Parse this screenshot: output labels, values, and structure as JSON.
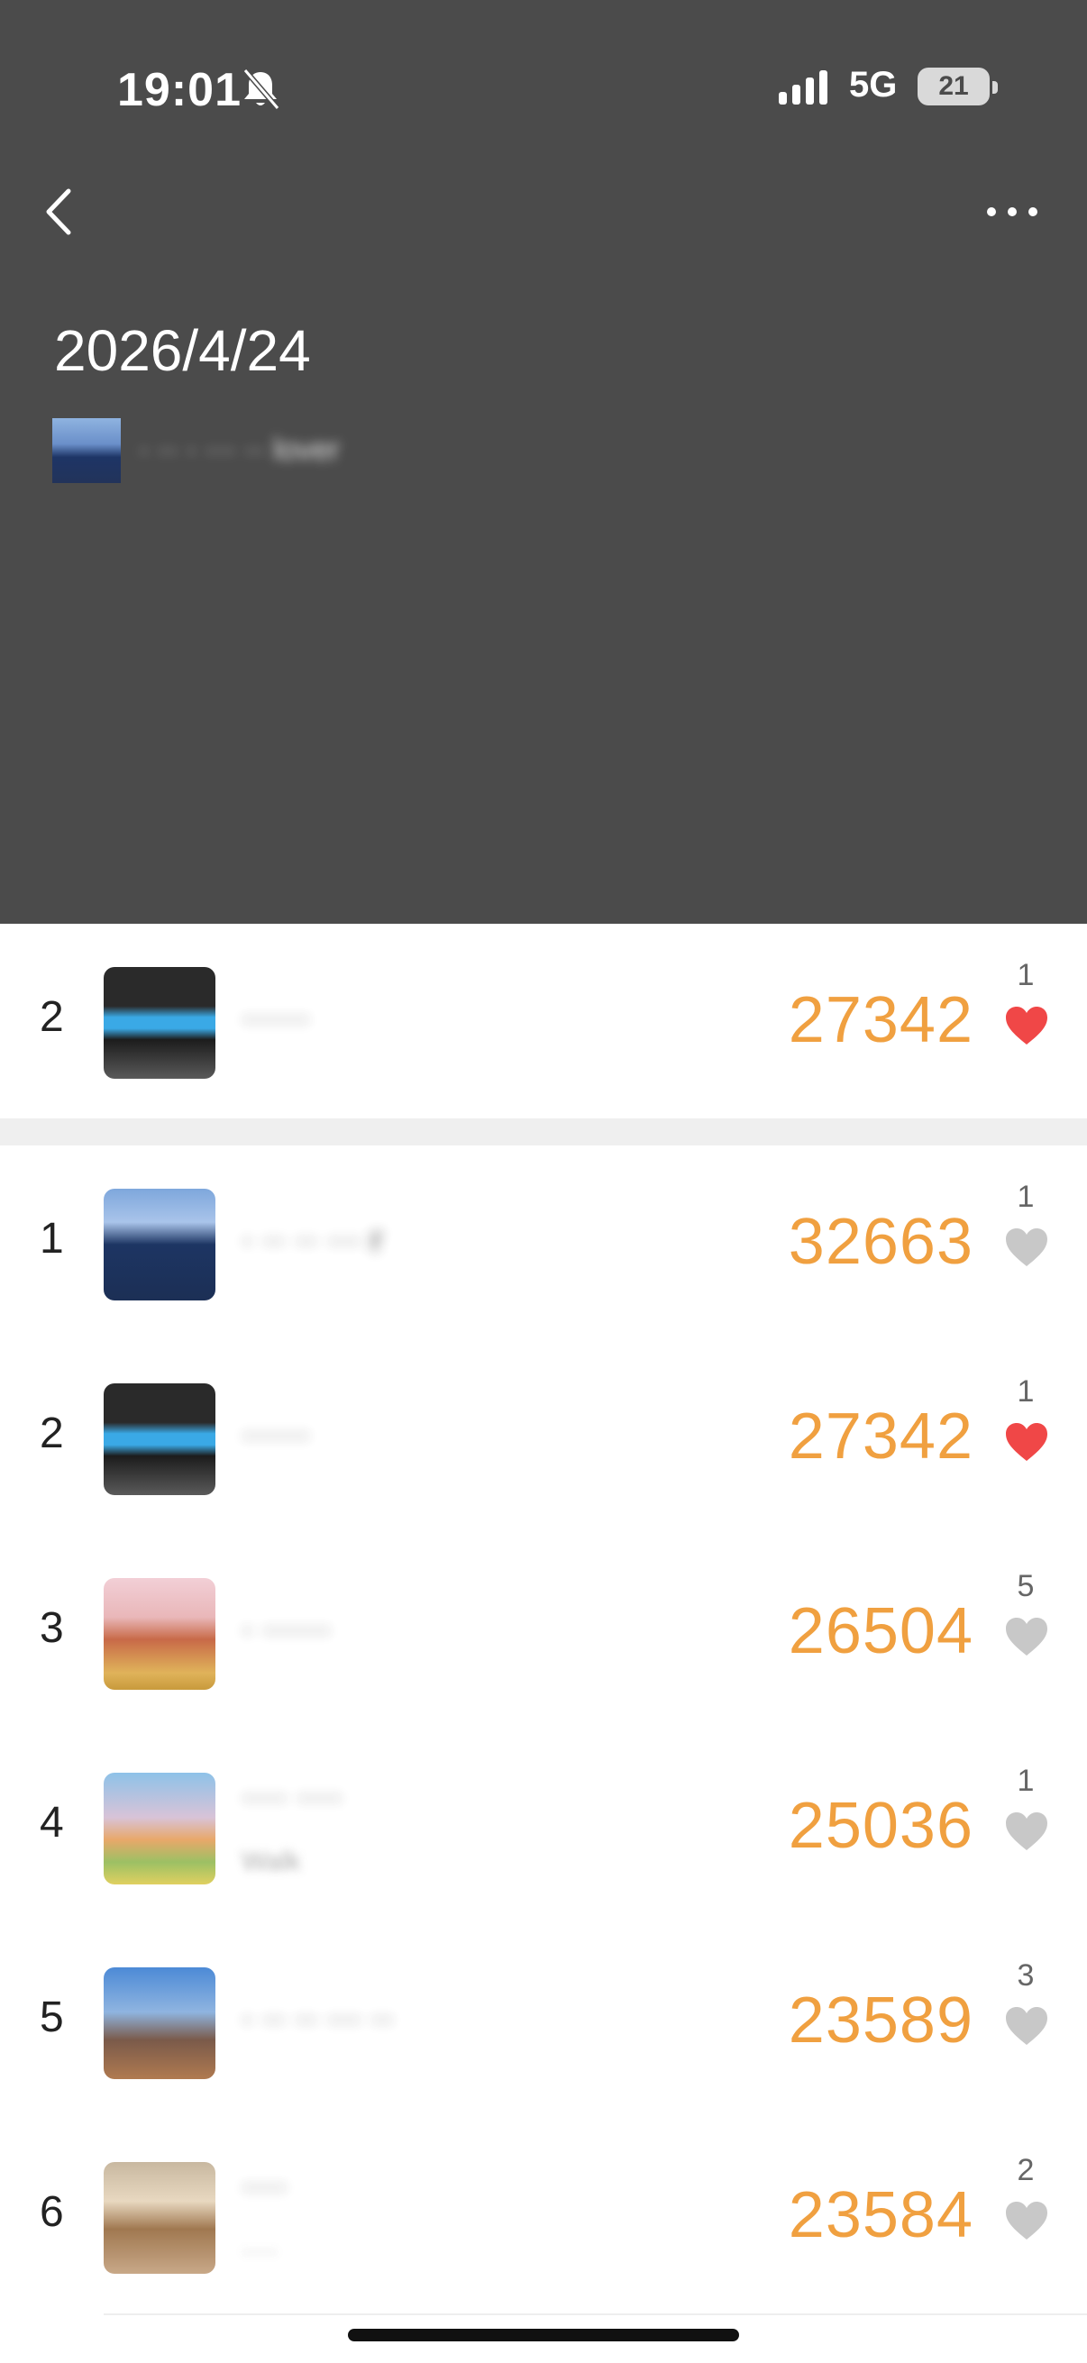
{
  "status_bar": {
    "time": "19:01",
    "network": "5G",
    "battery": "21"
  },
  "header": {
    "title": "2026/4/24",
    "playlist_label": "· ·· · ··· ·· lover"
  },
  "my_entry": {
    "rank": "2",
    "name": "······",
    "steps": "27342",
    "likes": "1",
    "liked": true
  },
  "leaderboard": [
    {
      "rank": "1",
      "name": "· ·· ·· ··· r",
      "subtitle": "",
      "steps": "32663",
      "likes": "1",
      "liked": false
    },
    {
      "rank": "2",
      "name": "······",
      "subtitle": "",
      "steps": "27342",
      "likes": "1",
      "liked": true
    },
    {
      "rank": "3",
      "name": "· ······",
      "subtitle": "",
      "steps": "26504",
      "likes": "5",
      "liked": false
    },
    {
      "rank": "4",
      "name": "···· ····",
      "subtitle": "Walk",
      "steps": "25036",
      "likes": "1",
      "liked": false
    },
    {
      "rank": "5",
      "name": "· ·· ·· ··· ··",
      "subtitle": "",
      "steps": "23589",
      "likes": "3",
      "liked": false
    },
    {
      "rank": "6",
      "name": "····",
      "subtitle": "····",
      "steps": "23584",
      "likes": "2",
      "liked": false
    }
  ],
  "colors": {
    "header_bg": "#4b4b4b",
    "steps": "#f0a040",
    "liked_heart": "#f04747",
    "heart_inactive": "#c8c8c8"
  },
  "icons": [
    "bell-slash-icon",
    "signal-icon",
    "battery-icon",
    "back-icon",
    "more-icon",
    "heart-icon"
  ]
}
